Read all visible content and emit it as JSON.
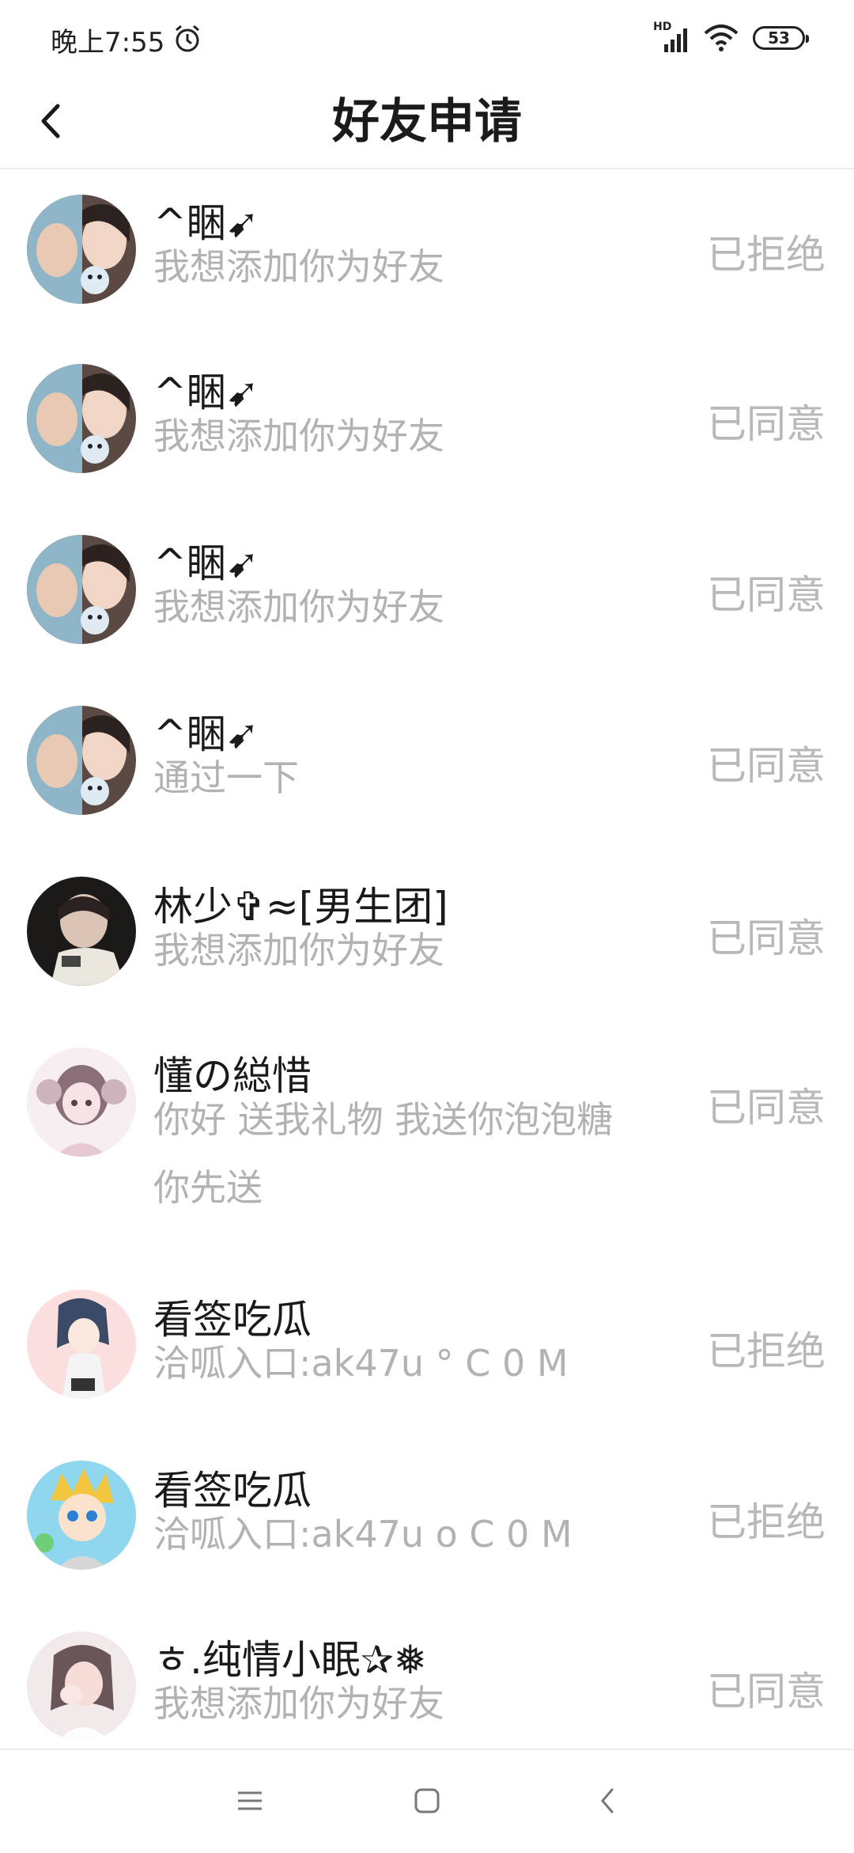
{
  "status_bar": {
    "time": "晚上7:55",
    "network": "HD",
    "battery": "53",
    "icons": [
      "alarm-icon",
      "signal-icon",
      "wifi-icon",
      "battery-icon"
    ]
  },
  "header": {
    "title": "好友申请",
    "back_icon": "chevron-left-icon"
  },
  "requests": [
    {
      "name": "^睏➹",
      "message": "我想添加你为好友",
      "status": "已拒绝",
      "avatar": "couple-photo-avatar"
    },
    {
      "name": "^睏➹",
      "message": "我想添加你为好友",
      "status": "已同意",
      "avatar": "couple-photo-avatar"
    },
    {
      "name": "^睏➹",
      "message": "我想添加你为好友",
      "status": "已同意",
      "avatar": "couple-photo-avatar"
    },
    {
      "name": "^睏➹",
      "message": "通过一下",
      "status": "已同意",
      "avatar": "couple-photo-avatar"
    },
    {
      "name": "林少✞≈[男生团]",
      "message": "我想添加你为好友",
      "status": "已同意",
      "avatar": "boy-photo-avatar"
    },
    {
      "name": "懂の縂惜",
      "message": "你好 送我礼物 我送你泡泡糖\n你先送",
      "status": "已同意",
      "avatar": "anime-girl-avatar"
    },
    {
      "name": "看签吃瓜",
      "message": "洽呱入口:ak47u ° C 0 M",
      "status": "已拒绝",
      "avatar": "anime-girl-pink-avatar"
    },
    {
      "name": "看签吃瓜",
      "message": "洽呱入口:ak47u o C 0 M",
      "status": "已拒绝",
      "avatar": "anime-boy-avatar"
    },
    {
      "name": "ㅎ.纯情小眠✰❅",
      "message": "我想添加你为好友",
      "status": "已同意",
      "avatar": "girl-photo-avatar"
    }
  ],
  "nav_bar": {
    "icons": [
      "menu-icon",
      "home-icon",
      "back-icon"
    ]
  },
  "colors": {
    "name_text": "#1a1a1a",
    "secondary_text": "#b2b2b2",
    "status_text": "#b8b8b8",
    "divider": "#ececec"
  }
}
